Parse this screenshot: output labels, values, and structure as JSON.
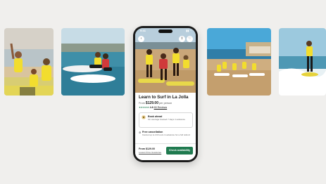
{
  "status_bar": {
    "time": "9:41",
    "icons": "▮▮ ◔"
  },
  "listing": {
    "title": "Learn to Surf in La Jolla",
    "price_prefix": "From",
    "price": "$129.00",
    "price_suffix": "per person",
    "stars": "★★★★★",
    "rating": "4.8",
    "reviews": "65 Reviews"
  },
  "card_book_ahead": {
    "title": "Book ahead",
    "subtitle": "On average booked 7 days in advance"
  },
  "free_cancellation": {
    "title": "Free cancellation",
    "subtitle": "Cancel up to 24 hours in advance for a full refund"
  },
  "footer": {
    "from_label": "From $129.00",
    "reserve_link": "Lowest Price Guarantee",
    "cta": "Check availability"
  },
  "icons": {
    "back": "back-arrow-icon",
    "share": "share-icon",
    "favorite": "heart-icon",
    "calendar": "calendar-icon",
    "cancel": "cancel-icon"
  },
  "colors": {
    "accent": "#1f7a4f",
    "background": "#f0efed"
  }
}
